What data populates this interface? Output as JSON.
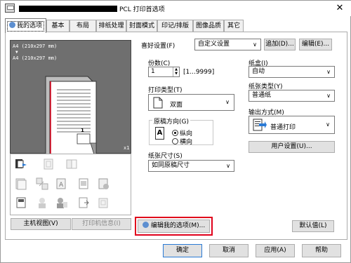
{
  "window": {
    "title_suffix": "PCL 打印首选项",
    "close_glyph": "✕"
  },
  "tabs": [
    {
      "label": "我的选项"
    },
    {
      "label": "基本"
    },
    {
      "label": "布局"
    },
    {
      "label": "排纸处理"
    },
    {
      "label": "封面模式"
    },
    {
      "label": "印记/排版"
    },
    {
      "label": "图像品质"
    },
    {
      "label": "其它"
    }
  ],
  "preview": {
    "line1": "A4 (210x297 mm)",
    "arrow": "▼",
    "line2": "A4 (210x297 mm)",
    "scale": "x1",
    "page_number": "1"
  },
  "left_buttons": {
    "main_view": "主机视图(V)",
    "printer_info": "打印机信息(I)"
  },
  "favorites": {
    "label": "喜好设置(F)",
    "value": "自定义设置",
    "add": "追加(D)...",
    "edit": "编辑(E)..."
  },
  "copies": {
    "label": "份数(C)",
    "value": "1",
    "range": "[1...9999]"
  },
  "print_type": {
    "label": "打印类型(T)",
    "value": "双面"
  },
  "orientation": {
    "label": "原稿方向(G)",
    "portrait": "纵向",
    "landscape": "横向",
    "selected": "纵向"
  },
  "paper_size": {
    "label": "纸张尺寸(S)",
    "value": "如同原稿尺寸"
  },
  "tray": {
    "label": "纸盒(I)",
    "value": "自动"
  },
  "paper_type": {
    "label": "纸张类型(Y)",
    "value": "普通纸"
  },
  "output": {
    "label": "输出方式(M)",
    "value": "普通打印"
  },
  "user_settings": "用户设置(U)...",
  "edit_my_options": "编辑我的选项(M)...",
  "default_button": "默认值(L)",
  "footer": {
    "ok": "确定",
    "cancel": "取消",
    "apply": "应用(A)",
    "help": "帮助"
  },
  "colors": {
    "highlight_red": "#e0001b",
    "preview_bg": "#6f6f6f"
  }
}
